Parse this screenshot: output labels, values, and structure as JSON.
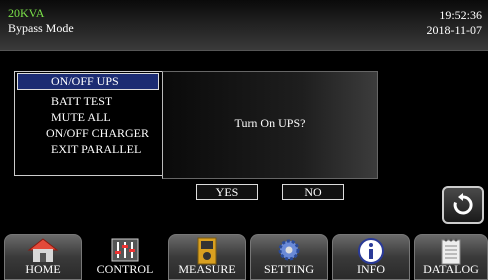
{
  "status": {
    "model": "20KVA",
    "mode": "Bypass Mode",
    "time": "19:52:36",
    "date": "2018-11-07"
  },
  "control_menu": [
    {
      "label": "ON/OFF UPS",
      "selected": true
    },
    {
      "label": "BATT TEST",
      "selected": false
    },
    {
      "label": "MUTE ALL",
      "selected": false
    },
    {
      "label": "ON/OFF CHARGER",
      "selected": false
    },
    {
      "label": "EXIT PARALLEL",
      "selected": false
    }
  ],
  "dialog": {
    "message": "Turn On UPS?",
    "yes_label": "YES",
    "no_label": "NO"
  },
  "tabs": [
    {
      "label": "HOME",
      "icon": "house-icon",
      "active": false
    },
    {
      "label": "CONTROL",
      "icon": "sliders-icon",
      "active": true
    },
    {
      "label": "MEASURE",
      "icon": "meter-icon",
      "active": false
    },
    {
      "label": "SETTING",
      "icon": "gear-icon",
      "active": false
    },
    {
      "label": "INFO",
      "icon": "info-icon",
      "active": false
    },
    {
      "label": "DATALOG",
      "icon": "notepad-icon",
      "active": false
    }
  ],
  "back_icon": "back-arrow-icon",
  "colors": {
    "model_text": "#7be24a",
    "selected_menu_bg": "#1c2c72"
  }
}
